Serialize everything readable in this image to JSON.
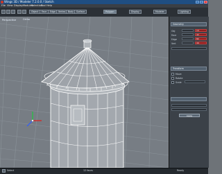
{
  "window": {
    "title": "Wings 3D / Modeler 7.2.0.0 / Sketch"
  },
  "menubar": {
    "items": [
      "File",
      "View",
      "Display",
      "Modules",
      "Selection",
      "Tool",
      "Help"
    ]
  },
  "toolbar": {
    "tabs": [
      "Object",
      "Face",
      "Edge",
      "Vertex",
      "Body",
      "Surface",
      "Polygon",
      "Display",
      "Modeler",
      "Lighting"
    ]
  },
  "viewport": {
    "label": "Perspective",
    "camera": "Ortho"
  },
  "rightpanel": {
    "header": "Geometry",
    "fields": [
      {
        "label": "Obj",
        "value": "13"
      },
      {
        "label": "Face",
        "value": "42"
      },
      {
        "label": "Edge",
        "value": "82"
      },
      {
        "label": "Vert",
        "value": "44"
      }
    ],
    "section_label": "Transform",
    "options": [
      {
        "label": "Move"
      },
      {
        "label": "Rotate"
      },
      {
        "label": "Scale"
      }
    ],
    "apply_button": "Apply"
  },
  "statusbar": {
    "left": "Select",
    "middle": "12 faces",
    "right": "Ready"
  },
  "colors": {
    "accent": "#c53a2a",
    "selection": "#ffffff",
    "grid": "#8d959c"
  }
}
